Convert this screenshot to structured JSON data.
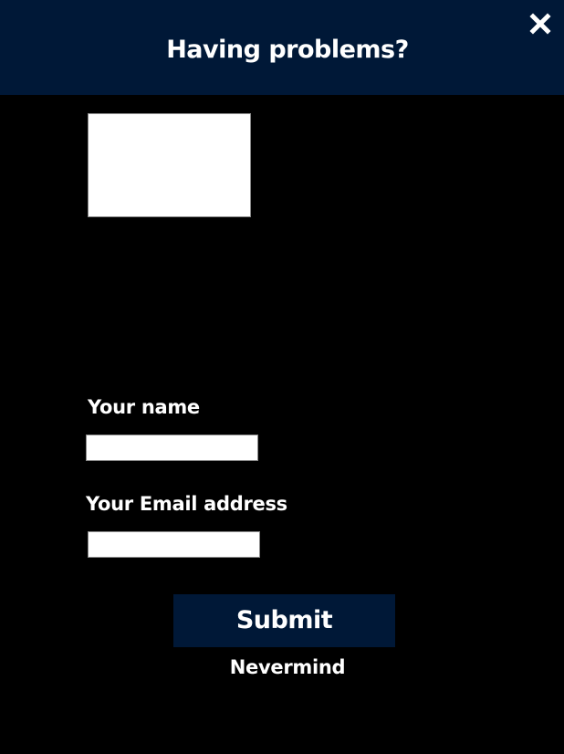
{
  "dialog": {
    "title": "Having problems?",
    "close_icon": "close-icon"
  },
  "form": {
    "problem_description": {
      "value": "",
      "placeholder": ""
    },
    "name": {
      "label": "Your name",
      "value": "",
      "placeholder": ""
    },
    "email": {
      "label": "Your Email address",
      "value": "",
      "placeholder": ""
    },
    "submit_label": "Submit",
    "cancel_label": "Nevermind"
  },
  "colors": {
    "background": "#000000",
    "header_background": "#001837",
    "button_background": "#001837",
    "text": "#ffffff",
    "input_background": "#ffffff"
  }
}
